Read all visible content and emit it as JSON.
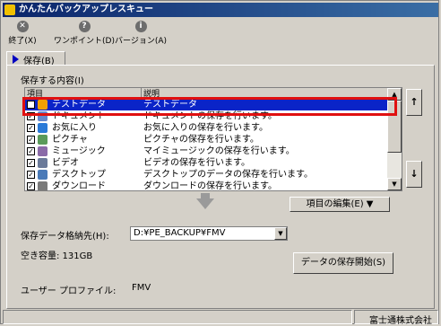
{
  "window": {
    "title": "かんたんバックアップレスキュー"
  },
  "toolbar": {
    "items": [
      {
        "label": "終了(X)",
        "icon": "close-icon"
      },
      {
        "label": "ワンポイント(D)",
        "icon": "help-icon"
      },
      {
        "label": "バージョン(A)",
        "icon": "info-icon"
      }
    ]
  },
  "tabs": [
    {
      "label": "保存(B)"
    }
  ],
  "content": {
    "group_label": "保存する内容(I)",
    "columns": [
      "項目",
      "説明"
    ],
    "rows": [
      {
        "name": "テストデータ",
        "desc": "テストデータ",
        "checked": true,
        "selected": true,
        "icon_color": "#f0a000"
      },
      {
        "name": "ドキュメント",
        "desc": "ドキュメントの保存を行います。",
        "checked": true,
        "selected": false,
        "icon_color": "#6688cc"
      },
      {
        "name": "お気に入り",
        "desc": "お気に入りの保存を行います。",
        "checked": true,
        "selected": false,
        "icon_color": "#2a7ad8"
      },
      {
        "name": "ピクチャ",
        "desc": "ピクチャの保存を行います。",
        "checked": true,
        "selected": false,
        "icon_color": "#5a9a5a"
      },
      {
        "name": "ミュージック",
        "desc": "マイミュージックの保存を行います。",
        "checked": true,
        "selected": false,
        "icon_color": "#8a6aa8"
      },
      {
        "name": "ビデオ",
        "desc": "ビデオの保存を行います。",
        "checked": true,
        "selected": false,
        "icon_color": "#6a7a9a"
      },
      {
        "name": "デスクトップ",
        "desc": "デスクトップのデータの保存を行います。",
        "checked": true,
        "selected": false,
        "icon_color": "#4a7ab8"
      },
      {
        "name": "ダウンロード",
        "desc": "ダウンロードの保存を行います。",
        "checked": true,
        "selected": false,
        "icon_color": "#7a7a7a"
      }
    ],
    "move_up": "↑",
    "move_down": "↓",
    "edit_button": "項目の編集(E) ▼",
    "dest_label": "保存データ格納先(H):",
    "dest_value": "D:¥PE_BACKUP¥FMV",
    "free_space": "空き容量: 131GB",
    "start_button": "データの保存開始(S)",
    "profile_label": "ユーザー プロファイル:",
    "profile_value": "FMV"
  },
  "status": {
    "company": "富士通株式会社"
  },
  "colors": {
    "selection": "#0a24c8",
    "highlight_box": "#e01010",
    "title_bar": "#0a246a"
  }
}
